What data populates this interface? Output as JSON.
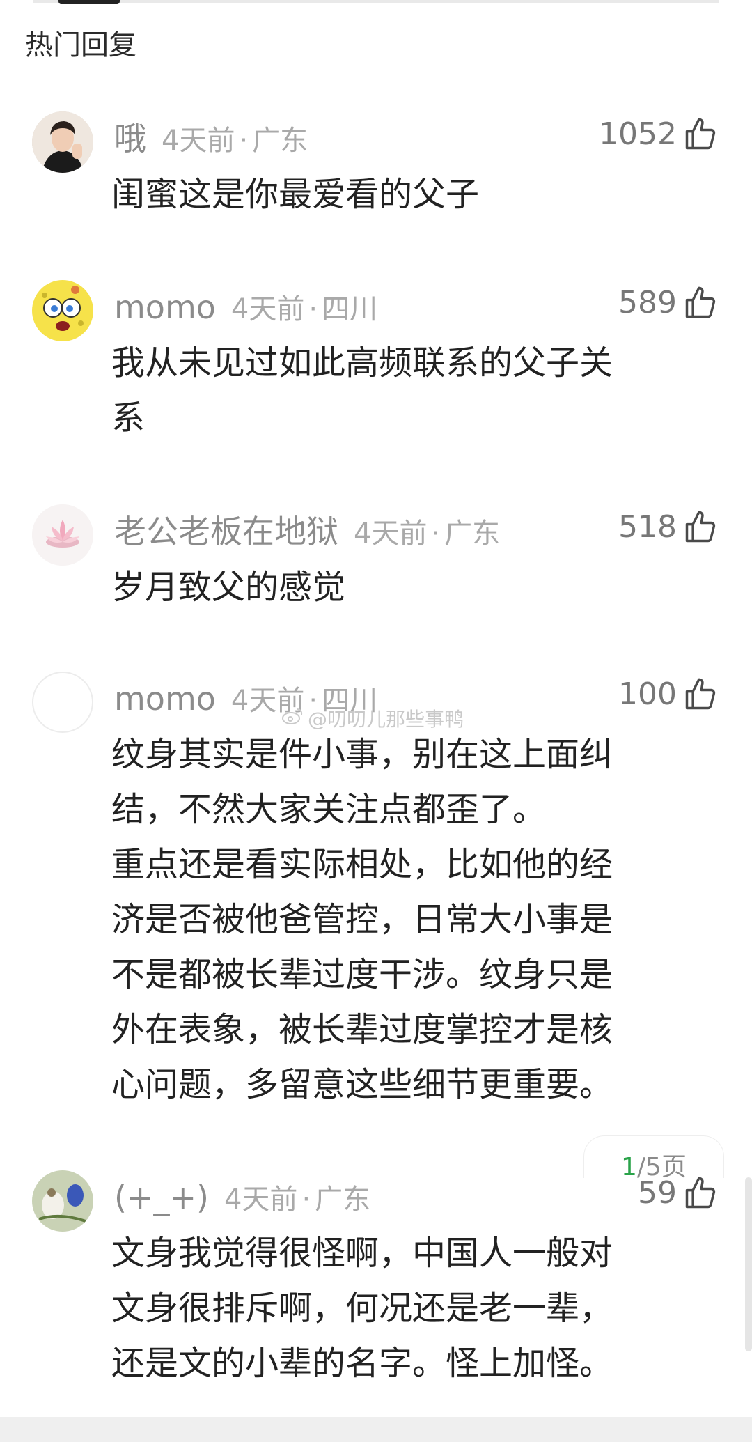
{
  "section_title": "热门回复",
  "watermark": "@叨叨儿那些事鸭",
  "pager": {
    "current": "1",
    "rest": "/5页"
  },
  "comments": [
    {
      "user": "哦",
      "time": "4天前",
      "dot": "·",
      "location": "广东",
      "likes": "1052",
      "text": "闺蜜这是你最爱看的父子"
    },
    {
      "user": "momo",
      "time": "4天前",
      "dot": "·",
      "location": "四川",
      "likes": "589",
      "text": "我从未见过如此高频联系的父子关\n系"
    },
    {
      "user": "老公老板在地狱",
      "time": "4天前",
      "dot": "·",
      "location": "广东",
      "likes": "518",
      "text": "岁月致父的感觉"
    },
    {
      "user": "momo",
      "time": "4天前",
      "dot": "·",
      "location": "四川",
      "likes": "100",
      "text": "纹身其实是件小事，别在这上面纠\n结，不然大家关注点都歪了。\n重点还是看实际相处，比如他的经\n济是否被他爸管控，日常大小事是\n不是都被长辈过度干涉。纹身只是\n外在表象，被长辈过度掌控才是核\n心问题，多留意这些细节更重要。"
    },
    {
      "user": "(+_+)",
      "time": "4天前",
      "dot": "·",
      "location": "广东",
      "likes": "59",
      "text": "文身我觉得很怪啊，中国人一般对\n文身很排斥啊，何况还是老一辈，\n还是文的小辈的名字。怪上加怪。"
    }
  ]
}
